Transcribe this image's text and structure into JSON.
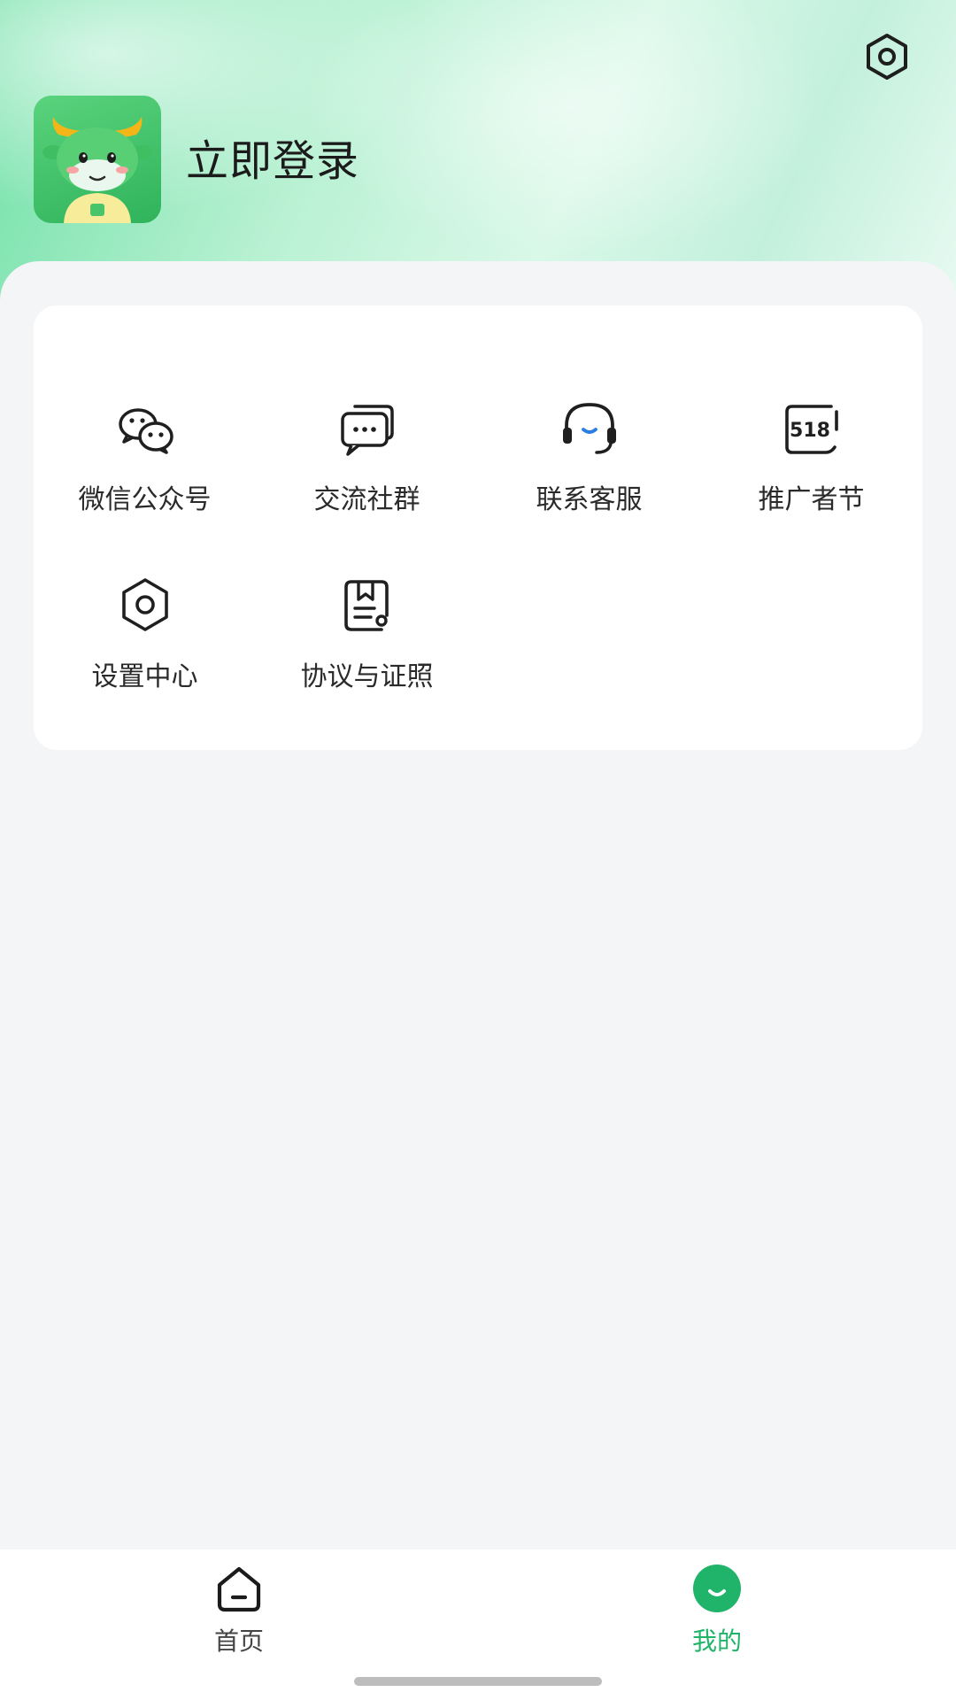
{
  "header": {
    "login_label": "立即登录",
    "settings_icon": "settings-hex-icon",
    "avatar_icon": "cow-mascot-avatar"
  },
  "menu": {
    "items": [
      {
        "label": "微信公众号",
        "icon": "wechat-icon"
      },
      {
        "label": "交流社群",
        "icon": "chat-group-icon"
      },
      {
        "label": "联系客服",
        "icon": "headset-icon"
      },
      {
        "label": "推广者节",
        "icon": "badge-518-icon",
        "badge_text": "518"
      },
      {
        "label": "设置中心",
        "icon": "settings-hex-icon"
      },
      {
        "label": "协议与证照",
        "icon": "document-icon"
      }
    ]
  },
  "bottom_nav": {
    "items": [
      {
        "label": "首页",
        "icon": "home-icon",
        "active": false
      },
      {
        "label": "我的",
        "icon": "profile-smile-icon",
        "active": true
      }
    ]
  },
  "colors": {
    "accent": "#1fb46a",
    "headset_mouth": "#2a7de1",
    "background": "#f4f5f7"
  }
}
